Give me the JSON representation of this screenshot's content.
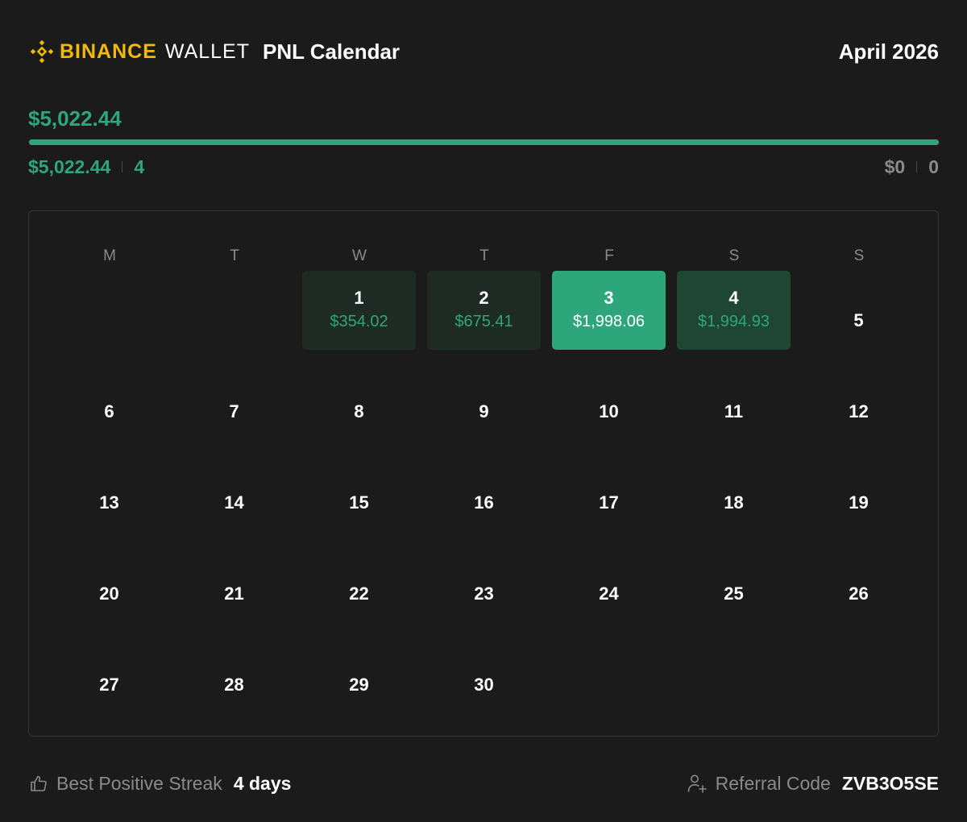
{
  "header": {
    "brand": "BINANCE",
    "product": "WALLET",
    "title": "PNL Calendar",
    "month": "April 2026"
  },
  "summary": {
    "total": "$5,022.44",
    "positive_total": "$5,022.44",
    "positive_days": "4",
    "negative_total": "$0",
    "negative_days": "0",
    "positive_share": 1.0
  },
  "calendar": {
    "weekdays": [
      "M",
      "T",
      "W",
      "T",
      "F",
      "S",
      "S"
    ],
    "days": [
      "1",
      "2",
      "3",
      "4",
      "5",
      "6",
      "7",
      "8",
      "9",
      "10",
      "11",
      "12",
      "13",
      "14",
      "15",
      "16",
      "17",
      "18",
      "19",
      "20",
      "21",
      "22",
      "23",
      "24",
      "25",
      "26",
      "27",
      "28",
      "29",
      "30"
    ],
    "pnl": [
      "$354.02",
      "$675.41",
      "$1,998.06",
      "$1,994.93"
    ]
  },
  "footer": {
    "streak_label": "Best Positive Streak",
    "streak_value": "4 days",
    "referral_label": "Referral Code",
    "referral_value": "ZVB3O5SE"
  },
  "colors": {
    "background": "#1b1b1b",
    "brand": "#f0b90b",
    "positive": "#2ea67c",
    "muted": "#8a8a8a"
  },
  "icons": {
    "logo": "binance-logo-icon",
    "streak": "thumbs-up-icon",
    "referral": "add-user-icon"
  }
}
